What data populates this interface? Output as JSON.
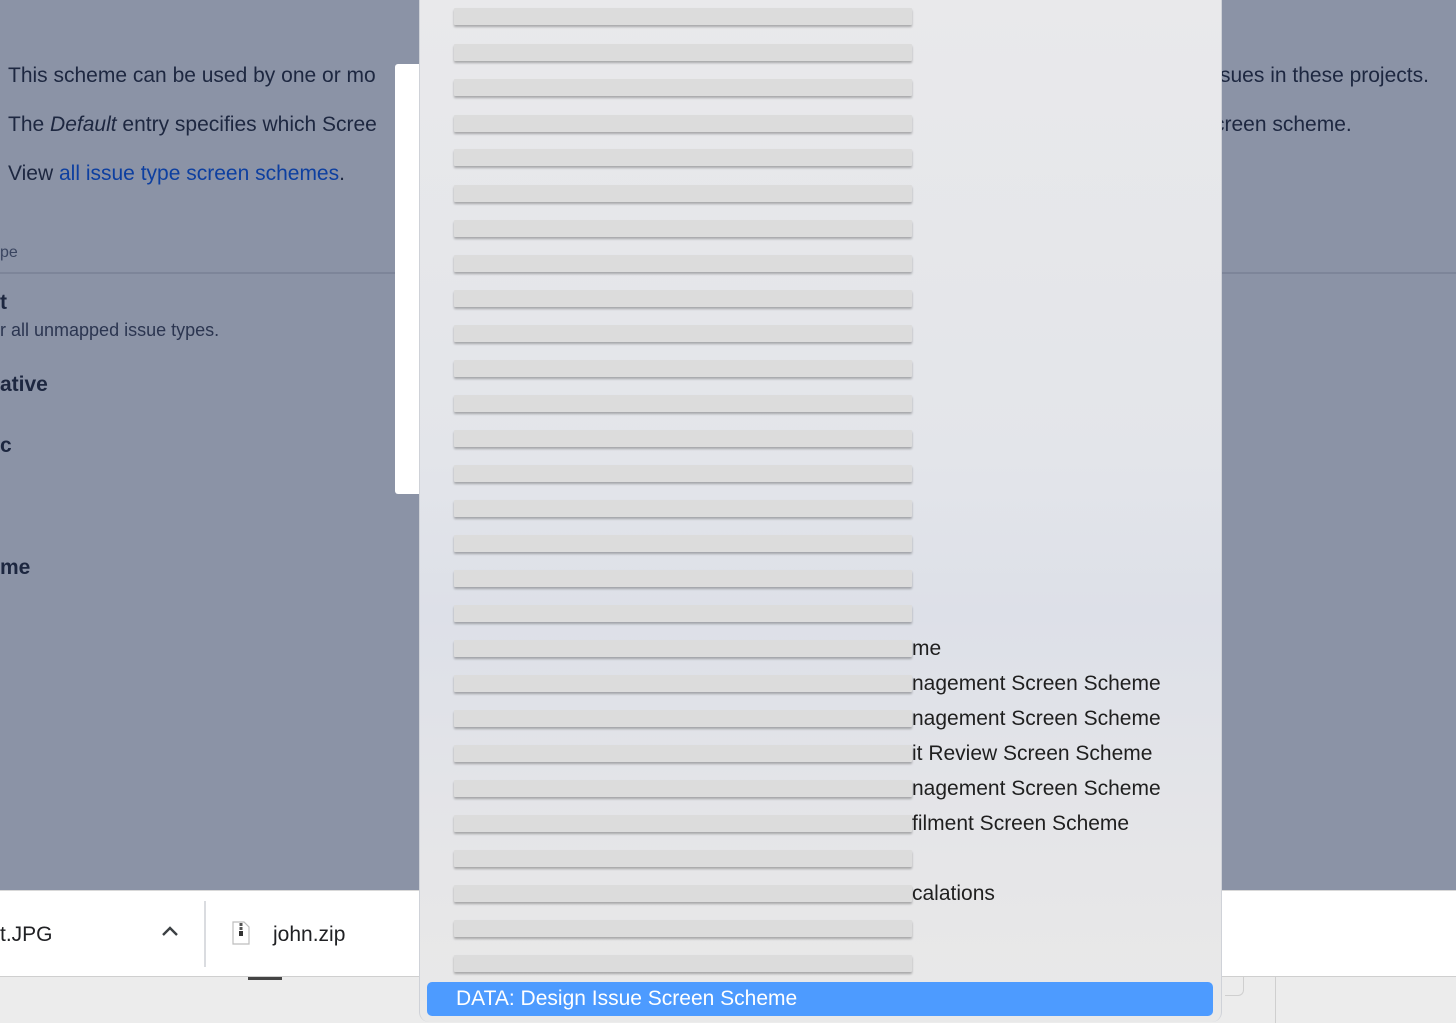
{
  "background_page": {
    "line1": "This scheme can be used by one or mo",
    "line1_tail": "sues in these projects.",
    "line2_prefix": "The ",
    "line2_em": "Default",
    "line2_mid": " entry specifies which Scree",
    "line2_tail": "creen scheme.",
    "line3_prefix": "View ",
    "line3_link": "all issue type screen schemes",
    "line3_suffix": ".",
    "column_header": "pe",
    "row_default_title": "t",
    "row_default_desc": "r all unmapped issue types.",
    "row_2_title": "ative",
    "row_3_title": "c",
    "row_4_title": "me"
  },
  "download_bar": {
    "file1_name": "t.JPG",
    "file2_name": "john.zip",
    "chevron_icon": "chevron-up-icon",
    "zip_icon": "zip-file-icon"
  },
  "dropdown": {
    "visible_option_tails": [
      "me",
      "nagement Screen Scheme",
      "nagement Screen Scheme",
      "it Review Screen Scheme",
      "nagement Screen Scheme",
      "filment Screen Scheme",
      "calations"
    ],
    "selected_option": "DATA: Design Issue Screen Scheme",
    "selected_color": "#4d9bff"
  }
}
